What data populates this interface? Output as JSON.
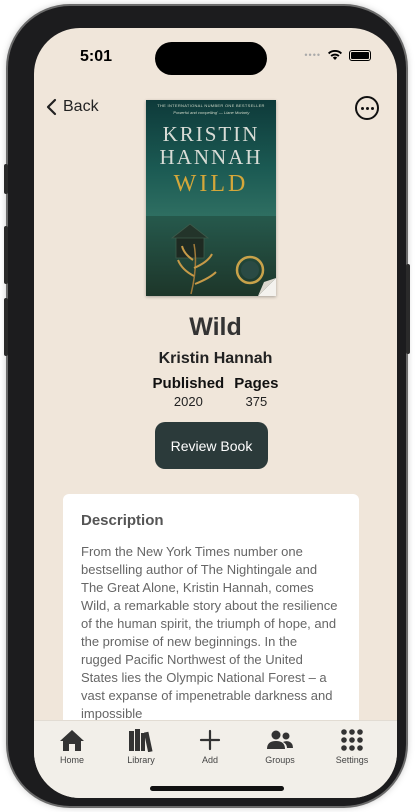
{
  "status_bar": {
    "time": "5:01"
  },
  "nav": {
    "back_label": "Back"
  },
  "cover": {
    "top_banner": "THE INTERNATIONAL NUMBER ONE BESTSELLER",
    "quote": "'Powerful and compelling' — Liane Moriarty",
    "author_line1": "KRISTIN",
    "author_line2": "HANNAH",
    "title": "WILD"
  },
  "book": {
    "title": "Wild",
    "author": "Kristin Hannah",
    "published_label": "Published",
    "published_value": "2020",
    "pages_label": "Pages",
    "pages_value": "375"
  },
  "actions": {
    "review_label": "Review Book"
  },
  "description": {
    "heading": "Description",
    "text": "From the New York Times number one bestselling author of The Nightingale and The Great Alone, Kristin Hannah, comes Wild, a remarkable story about the resilience of the human spirit, the triumph of hope, and the promise of new beginnings. In the rugged Pacific Northwest of the United States lies the Olympic National Forest – a vast expanse of impenetrable darkness and impossible"
  },
  "tabbar": {
    "items": [
      {
        "label": "Home",
        "icon": "house-icon"
      },
      {
        "label": "Library",
        "icon": "books-icon"
      },
      {
        "label": "Add",
        "icon": "plus-icon"
      },
      {
        "label": "Groups",
        "icon": "people-icon"
      },
      {
        "label": "Settings",
        "icon": "grid-icon"
      }
    ]
  },
  "colors": {
    "background": "#f0e6da",
    "button": "#2b3a3a",
    "card": "#ffffff"
  }
}
